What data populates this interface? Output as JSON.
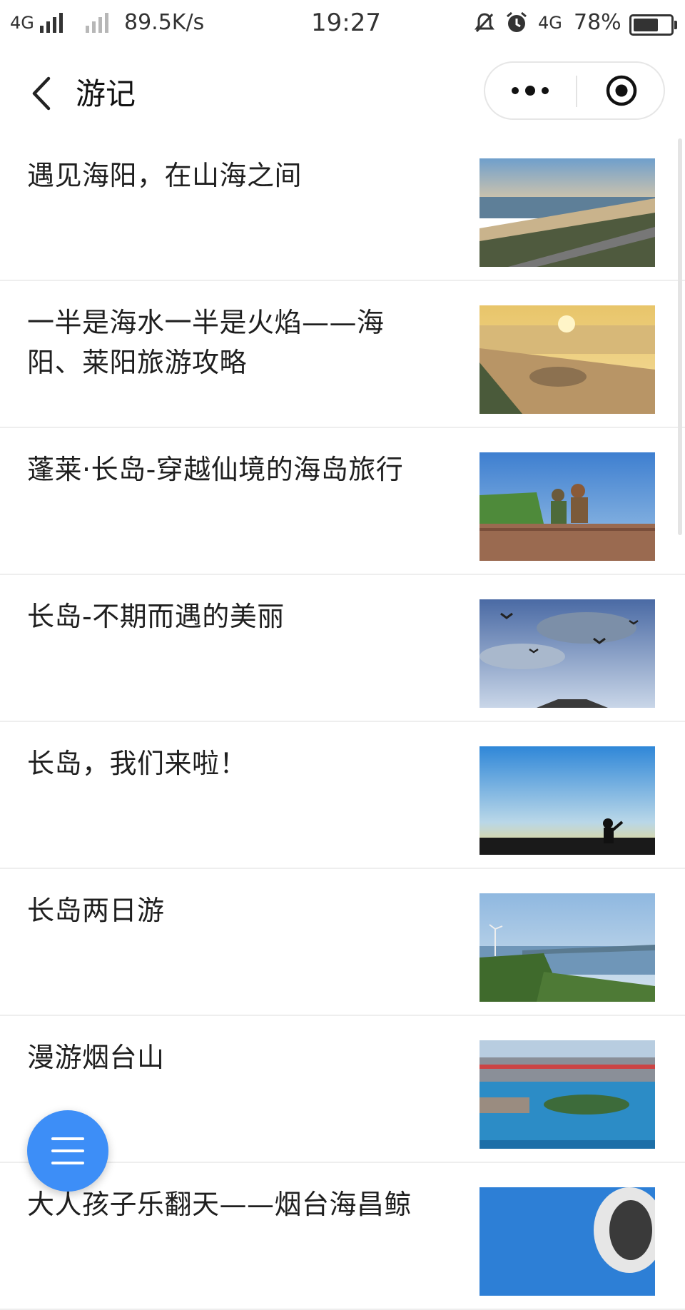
{
  "status_bar": {
    "network_left": "4G",
    "speed": "89.5K/s",
    "time": "19:27",
    "network_right": "4G",
    "battery": "78%",
    "battery_level": 0.78
  },
  "navbar": {
    "title": "游记"
  },
  "articles": [
    {
      "title": "遇见海阳，在山海之间",
      "image": "coastal-city-beach-photo"
    },
    {
      "title": "一半是海水一半是火焰——海阳、莱阳旅游攻略",
      "image": "sunset-beach-plaza-photo"
    },
    {
      "title": "蓬莱·长岛-穿越仙境的海岛旅行",
      "image": "children-on-wall-photo"
    },
    {
      "title": "长岛-不期而遇的美丽",
      "image": "seagulls-sky-photo"
    },
    {
      "title": "长岛，我们来啦！",
      "image": "silhouette-sunset-photo"
    },
    {
      "title": "长岛两日游",
      "image": "wind-turbine-hill-photo"
    },
    {
      "title": "漫游烟台山",
      "image": "harbor-city-aerial-photo"
    },
    {
      "title": "大人孩子乐翻天——烟台海昌鲸",
      "image": "aquarium-building-photo"
    }
  ],
  "colors": {
    "accent": "#3d8ef7",
    "divider": "#eeeeee"
  }
}
